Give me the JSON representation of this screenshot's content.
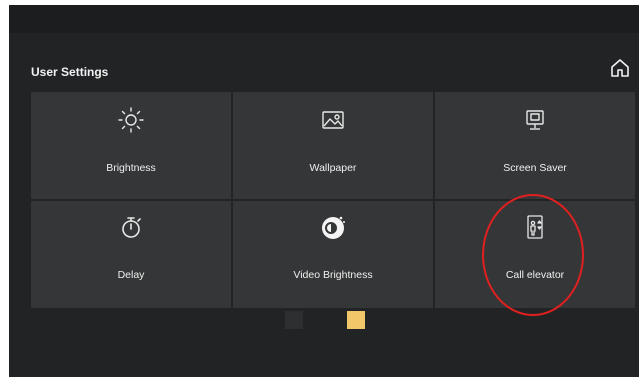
{
  "header": {
    "title": "User Settings",
    "home_icon": "home-icon"
  },
  "tiles": [
    {
      "label": "Brightness",
      "icon": "sun-icon"
    },
    {
      "label": "Wallpaper",
      "icon": "image-icon"
    },
    {
      "label": "Screen Saver",
      "icon": "monitor-icon"
    },
    {
      "label": "Delay",
      "icon": "stopwatch-icon"
    },
    {
      "label": "Video Brightness",
      "icon": "video-brightness-icon"
    },
    {
      "label": "Call elevator",
      "icon": "elevator-icon",
      "highlighted": true
    }
  ],
  "pager": {
    "pages": 2,
    "active_page": 2,
    "active_color": "#f2c76a",
    "inactive_color": "#2e2f30"
  },
  "colors": {
    "highlight": "#e02020",
    "background": "#222324",
    "tile": "#353637"
  }
}
